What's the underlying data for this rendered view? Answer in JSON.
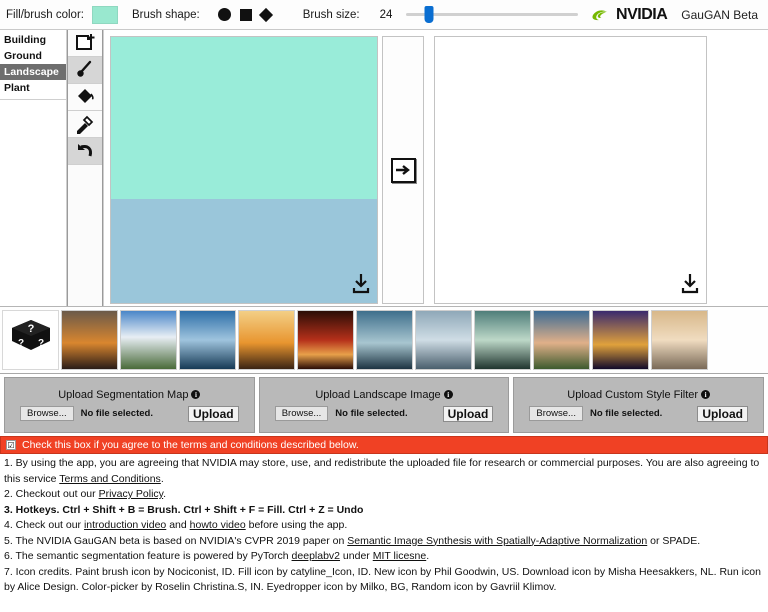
{
  "toolbar": {
    "fill_color_label": "Fill/brush color:",
    "fill_color_value": "#99e8cf",
    "brush_shape_label": "Brush shape:",
    "brush_shapes": [
      "circle",
      "square",
      "diamond"
    ],
    "brush_size_label": "Brush size:",
    "brush_size_value": "24",
    "slider_position_pct": 13,
    "brand_name": "NVIDIA",
    "app_name": "GauGAN Beta"
  },
  "sidebar": {
    "categories": [
      {
        "label": "Building",
        "selected": false
      },
      {
        "label": "Ground",
        "selected": false
      },
      {
        "label": "Landscape",
        "selected": true
      },
      {
        "label": "Plant",
        "selected": false
      }
    ],
    "tools": [
      {
        "name": "new-canvas-icon",
        "active": false
      },
      {
        "name": "paint-brush-icon",
        "active": true
      },
      {
        "name": "fill-bucket-icon",
        "active": false
      },
      {
        "name": "eyedropper-icon",
        "active": false
      },
      {
        "name": "undo-icon",
        "active": true
      }
    ]
  },
  "canvas": {
    "segmentation": {
      "sky_color": "#99ecd9",
      "sea_color": "#9ac6da",
      "sky_height_pct": 61,
      "download_icon": "download-icon"
    },
    "run_button_icon": "arrow-right-icon",
    "output": {
      "background": "#ffffff",
      "download_icon": "download-icon"
    }
  },
  "thumbnails": {
    "random_icon": "random-dice-icon",
    "items": [
      {
        "name": "sunset-cliff",
        "c1": "#5b4a44",
        "c2": "#d9862f",
        "c3": "#2a1d18"
      },
      {
        "name": "road-clouds",
        "c1": "#4a86c8",
        "c2": "#e8eef4",
        "c3": "#4a6b3a"
      },
      {
        "name": "blue-lake",
        "c1": "#2e6fa8",
        "c2": "#9fc4de",
        "c3": "#173a55"
      },
      {
        "name": "orange-sunset-sea",
        "c1": "#e8952f",
        "c2": "#f3cf86",
        "c3": "#3a2414"
      },
      {
        "name": "red-sunset",
        "c1": "#b5301a",
        "c2": "#e8a04a",
        "c3": "#2b0d06"
      },
      {
        "name": "dusk-shore",
        "c1": "#3f6f8c",
        "c2": "#a8c6d0",
        "c3": "#1d3442"
      },
      {
        "name": "grey-sea",
        "c1": "#8fa8b8",
        "c2": "#cfdde5",
        "c3": "#4a5f6d"
      },
      {
        "name": "green-lagoon",
        "c1": "#4f7e7a",
        "c2": "#bdd8c8",
        "c3": "#20352f"
      },
      {
        "name": "cloud-field",
        "c1": "#3d6c94",
        "c2": "#e0b089",
        "c3": "#3d5a2e"
      },
      {
        "name": "purple-night",
        "c1": "#3a2a6e",
        "c2": "#e0a13c",
        "c3": "#120a2a"
      },
      {
        "name": "pale-sunset",
        "c1": "#d8b88a",
        "c2": "#f0dcc0",
        "c3": "#7a6a58"
      }
    ]
  },
  "uploads": [
    {
      "title": "Upload Segmentation Map",
      "info_icon": "info-icon",
      "browse_label": "Browse...",
      "file_status": "No file selected.",
      "upload_label": "Upload"
    },
    {
      "title": "Upload Landscape Image",
      "info_icon": "info-icon",
      "browse_label": "Browse...",
      "file_status": "No file selected.",
      "upload_label": "Upload"
    },
    {
      "title": "Upload Custom Style Filter",
      "info_icon": "info-icon",
      "browse_label": "Browse...",
      "file_status": "No file selected.",
      "upload_label": "Upload"
    }
  ],
  "terms": {
    "banner_color": "#f04124",
    "banner_text": "Check this box if you agree to the terms and conditions described below.",
    "checkbox_checked": true,
    "checkbox_glyph": "☑",
    "line1_a": "1. By using the app, you are agreeing that NVIDIA may store, use, and redistribute the uploaded file for research or commercial purposes. You are also agreeing to this service ",
    "line1_link": "Terms and Conditions",
    "line1_b": ".",
    "line2_a": "2. Checkout out our ",
    "line2_link": "Privacy Policy",
    "line2_b": ".",
    "line3": "3. Hotkeys. Ctrl + Shift + B = Brush. Ctrl + Shift + F = Fill. Ctrl + Z = Undo",
    "line4_a": "4. Check out our ",
    "line4_link1": "introduction video",
    "line4_mid": " and ",
    "line4_link2": "howto video",
    "line4_b": " before using the app.",
    "line5_a": "5. The NVIDIA GauGAN beta is based on NVIDIA's CVPR 2019 paper on ",
    "line5_link": "Semantic Image Synthesis with Spatially-Adaptive Normalization",
    "line5_b": " or SPADE.",
    "line6_a": "6. The semantic segmentation feature is powered by PyTorch ",
    "line6_link1": "deeplabv2",
    "line6_mid": " under ",
    "line6_link2": "MIT licesne",
    "line6_b": ".",
    "line7": "7. Icon credits. Paint brush icon by Nociconist, ID. Fill icon by catyline_Icon, ID. New icon by Phil Goodwin, US. Download icon by Misha Heesakkers, NL. Run icon by Alice Design. Color-picker by Roselin Christina.S, IN. Eyedropper icon by Milko, BG, Random icon by Gavriil Klimov."
  }
}
